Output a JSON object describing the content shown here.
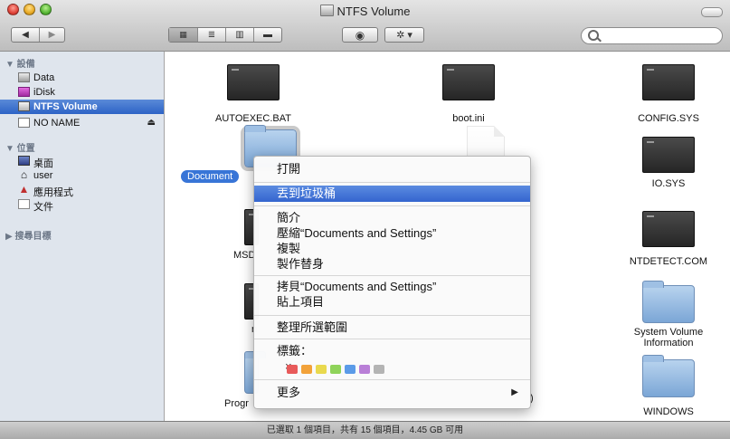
{
  "window": {
    "title": "NTFS Volume"
  },
  "toolbar": {
    "back": "◀",
    "forward": "▶",
    "view_icon": "view-icon-grid",
    "view_list": "view-icon-list",
    "view_column": "view-icon-columns",
    "view_coverflow": "view-icon-coverflow",
    "quicklook": "eye-icon",
    "action": "gear-icon",
    "search_placeholder": ""
  },
  "sidebar": {
    "devices_label": "▼ 設備",
    "devices": [
      {
        "label": "Data",
        "icon": "drive-icon"
      },
      {
        "label": "iDisk",
        "icon": "idisk-icon"
      },
      {
        "label": "NTFS Volume",
        "icon": "drive-icon",
        "selected": true
      },
      {
        "label": "NO NAME",
        "icon": "drive-icon",
        "eject": "⏏"
      }
    ],
    "places_label": "▼ 位置",
    "places": [
      {
        "label": "桌面",
        "icon": "desktop-icon"
      },
      {
        "label": "user",
        "icon": "home-icon"
      },
      {
        "label": "應用程式",
        "icon": "applications-icon"
      },
      {
        "label": "文件",
        "icon": "documents-icon"
      }
    ],
    "search_label": "▶ 搜尋目標"
  },
  "files": [
    {
      "name": "AUTOEXEC.BAT",
      "kind": "doc"
    },
    {
      "name": "boot.ini",
      "kind": "doc"
    },
    {
      "name": "CONFIG.SYS",
      "kind": "doc"
    },
    {
      "name": "Document",
      "kind": "folder",
      "selected": true
    },
    {
      "name": "IO.SYS",
      "kind": "doc"
    },
    {
      "name": "MSD",
      "kind": "doc"
    },
    {
      "name": "NTDETECT.COM",
      "kind": "doc"
    },
    {
      "name": "n",
      "kind": "doc"
    },
    {
      "name": "System Volume Information",
      "kind": "folder"
    },
    {
      "name": "Progr",
      "kind": "folder"
    },
    {
      "name": ")",
      "kind": "folder"
    },
    {
      "name": "WINDOWS",
      "kind": "folder"
    }
  ],
  "context_menu": {
    "open": "打開",
    "move_to_trash": "丟到垃圾桶",
    "get_info": "簡介",
    "compress": "壓縮“Documents and Settings”",
    "duplicate": "複製",
    "make_alias": "製作替身",
    "copy": "拷貝“Documents and Settings”",
    "paste": "貼上項目",
    "clean_up": "整理所選範圍",
    "label": "標籤：",
    "no_label": "×",
    "label_colors": [
      "#e85a5a",
      "#f2a23a",
      "#e9d94e",
      "#8fd35a",
      "#5b9be8",
      "#b97fd7",
      "#b4b4b4"
    ],
    "more": "更多",
    "more_arrow": "▶"
  },
  "status": "已選取 1 個項目，共有 15 個項目，4.45 GB 可用"
}
